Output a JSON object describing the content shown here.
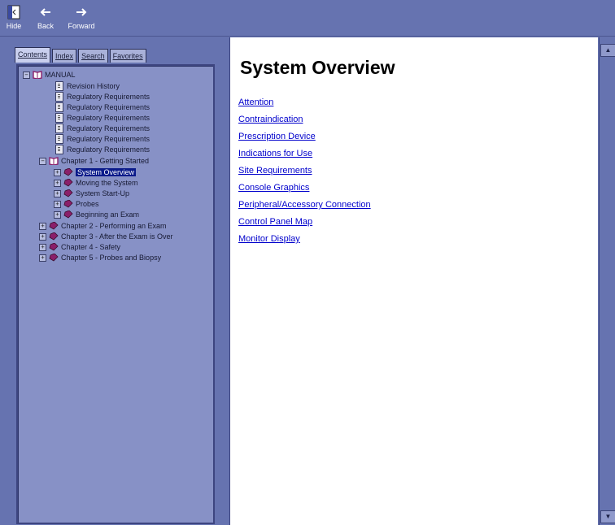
{
  "toolbar": {
    "hide_label": "Hide",
    "back_label": "Back",
    "forward_label": "Forward"
  },
  "tabs": [
    {
      "label": "Contents",
      "active": true
    },
    {
      "label": "Index",
      "active": false
    },
    {
      "label": "Search",
      "active": false
    },
    {
      "label": "Favorites",
      "active": false
    }
  ],
  "tree": {
    "root": "MANUAL",
    "pages": [
      "Revision History",
      "Regulatory Requirements",
      "Regulatory Requirements",
      "Regulatory Requirements",
      "Regulatory Requirements",
      "Regulatory Requirements",
      "Regulatory Requirements"
    ],
    "chapter1": "Chapter 1 - Getting Started",
    "chapter1_items": [
      "System Overview",
      "Moving the System",
      "System Start-Up",
      "Probes",
      "Beginning an Exam"
    ],
    "selected": "System Overview",
    "chapters": [
      "Chapter 2 - Performing an Exam",
      "Chapter 3 - After the Exam is Over",
      "Chapter 4 - Safety",
      "Chapter 5 - Probes and Biopsy"
    ]
  },
  "content": {
    "title": "System Overview",
    "links": [
      "Attention",
      "Contraindication",
      "Prescription Device",
      "Indications for Use",
      "Site Requirements",
      "Console Graphics",
      "Peripheral/Accessory Connection",
      "Control Panel Map",
      "Monitor Display"
    ]
  },
  "colors": {
    "frame": "#6673b0",
    "tree_bg": "#8791c6",
    "selection": "#0a1a8a",
    "link": "#0000cc",
    "book": "#8a1f6a"
  }
}
